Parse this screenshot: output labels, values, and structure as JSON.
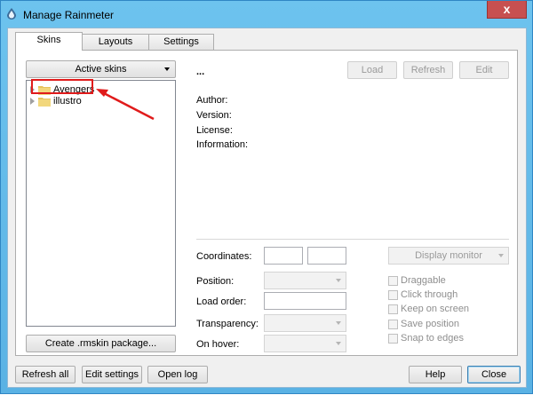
{
  "window": {
    "title": "Manage Rainmeter",
    "close_glyph": "x"
  },
  "tabs": [
    {
      "label": "Skins"
    },
    {
      "label": "Layouts"
    },
    {
      "label": "Settings"
    }
  ],
  "skins_panel": {
    "active_skins_label": "Active skins",
    "tree_items": [
      {
        "label": "Avengers"
      },
      {
        "label": "illustro"
      }
    ],
    "create_package_label": "Create .rmskin package..."
  },
  "details": {
    "skin_name": "...",
    "load_label": "Load",
    "refresh_label": "Refresh",
    "edit_label": "Edit",
    "author_label": "Author:",
    "version_label": "Version:",
    "license_label": "License:",
    "information_label": "Information:"
  },
  "settings": {
    "coordinates_label": "Coordinates:",
    "position_label": "Position:",
    "load_order_label": "Load order:",
    "transparency_label": "Transparency:",
    "on_hover_label": "On hover:",
    "display_monitor_label": "Display monitor",
    "checkboxes": [
      {
        "label": "Draggable"
      },
      {
        "label": "Click through"
      },
      {
        "label": "Keep on screen"
      },
      {
        "label": "Save position"
      },
      {
        "label": "Snap to edges"
      }
    ]
  },
  "footer": {
    "refresh_all_label": "Refresh all",
    "edit_settings_label": "Edit settings",
    "open_log_label": "Open log",
    "help_label": "Help",
    "close_label": "Close"
  },
  "annotation_color": "#e01b1b"
}
